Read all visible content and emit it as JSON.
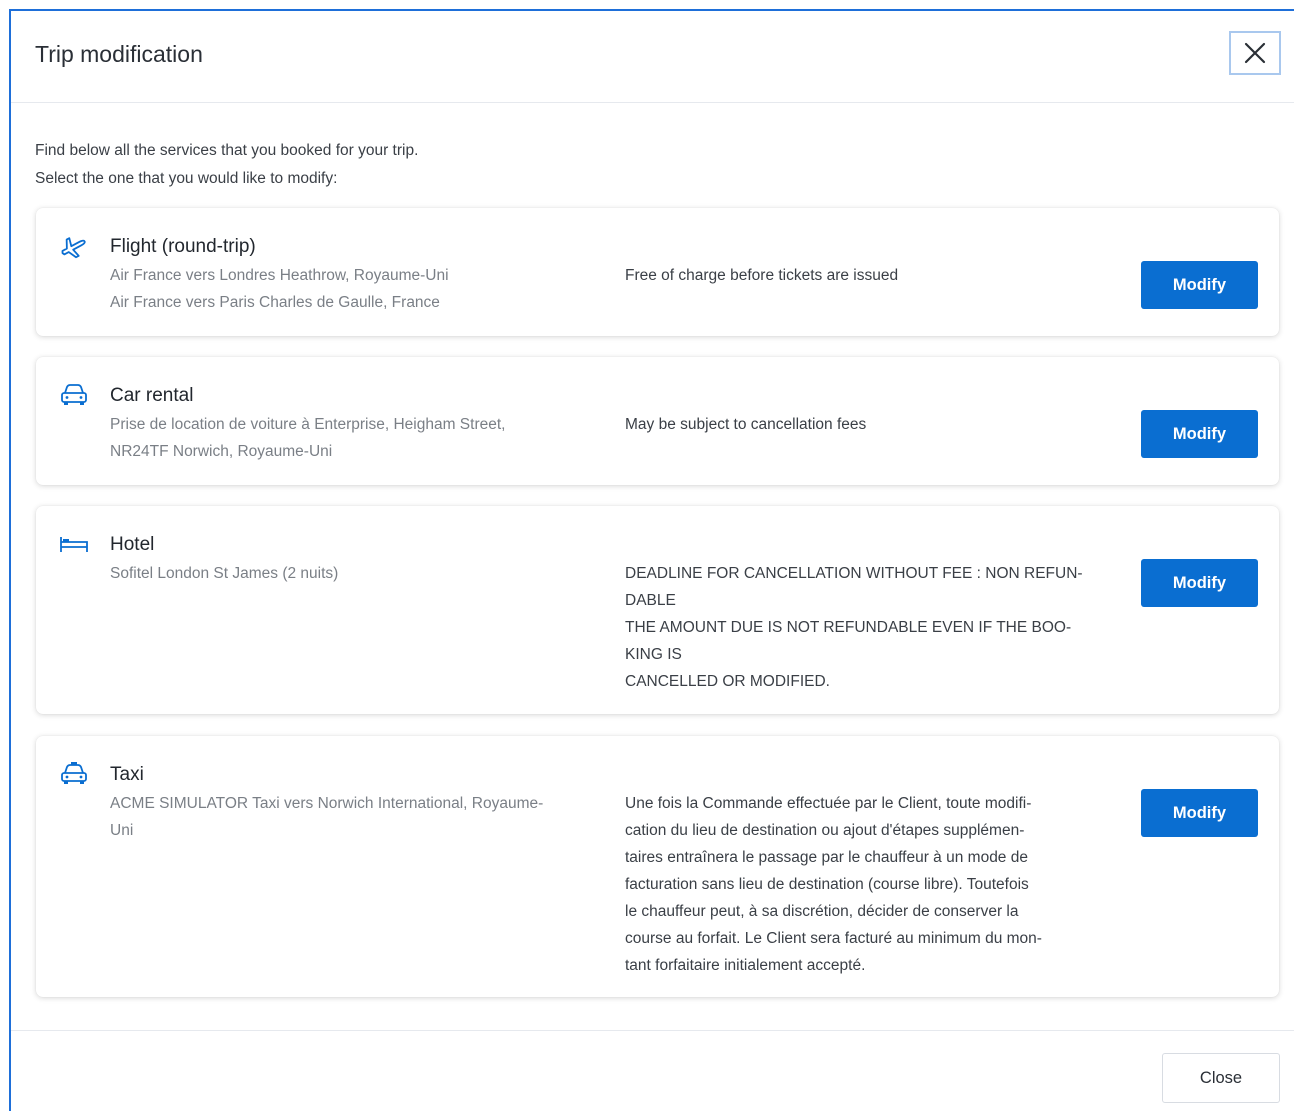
{
  "dialog": {
    "title": "Trip modification",
    "intro_line1": "Find below all the services that you booked for your trip.",
    "intro_line2": "Select the one that you would like to modify:",
    "close_label": "Close"
  },
  "services": [
    {
      "icon": "airplane-icon",
      "name": "Flight (round-trip)",
      "details": [
        "Air France vers Londres Heathrow, Royaume-Uni",
        "Air France vers Paris Charles de Gaulle, France"
      ],
      "policy": [
        "Free of charge before tickets are issued"
      ],
      "button": "Modify"
    },
    {
      "icon": "car-icon",
      "name": "Car rental",
      "details": [
        "Prise de location de voiture à Enterprise, Heigham Street,",
        "NR24TF Norwich, Royaume-Uni"
      ],
      "policy": [
        "May be subject to cancellation fees"
      ],
      "button": "Modify"
    },
    {
      "icon": "bed-icon",
      "name": "Hotel",
      "details": [
        "Sofitel London St James (2 nuits)"
      ],
      "policy": [
        "DEADLINE FOR CANCELLATION WITHOUT FEE : NON REFUN-",
        "DABLE",
        "THE AMOUNT DUE IS NOT REFUNDABLE EVEN IF THE BOO-",
        "KING IS",
        "CANCELLED OR MODIFIED."
      ],
      "button": "Modify"
    },
    {
      "icon": "taxi-icon",
      "name": "Taxi",
      "details": [
        "ACME SIMULATOR Taxi vers Norwich International, Royaume-",
        "Uni"
      ],
      "policy": [
        "Une fois la Commande effectuée par le Client, toute modifi-",
        "cation du lieu de destination ou ajout d'étapes supplémen-",
        "taires entraînera le passage par le chauffeur à un mode de",
        "facturation sans lieu de destination (course libre). Toutefois",
        "le chauffeur peut, à sa discrétion, décider de conserver la",
        "course au forfait. Le Client sera facturé au minimum du mon-",
        "tant forfaitaire initialement accepté."
      ],
      "button": "Modify"
    }
  ],
  "colors": {
    "accent": "#0a6ed1",
    "focus_border": "#1e6fd9"
  }
}
